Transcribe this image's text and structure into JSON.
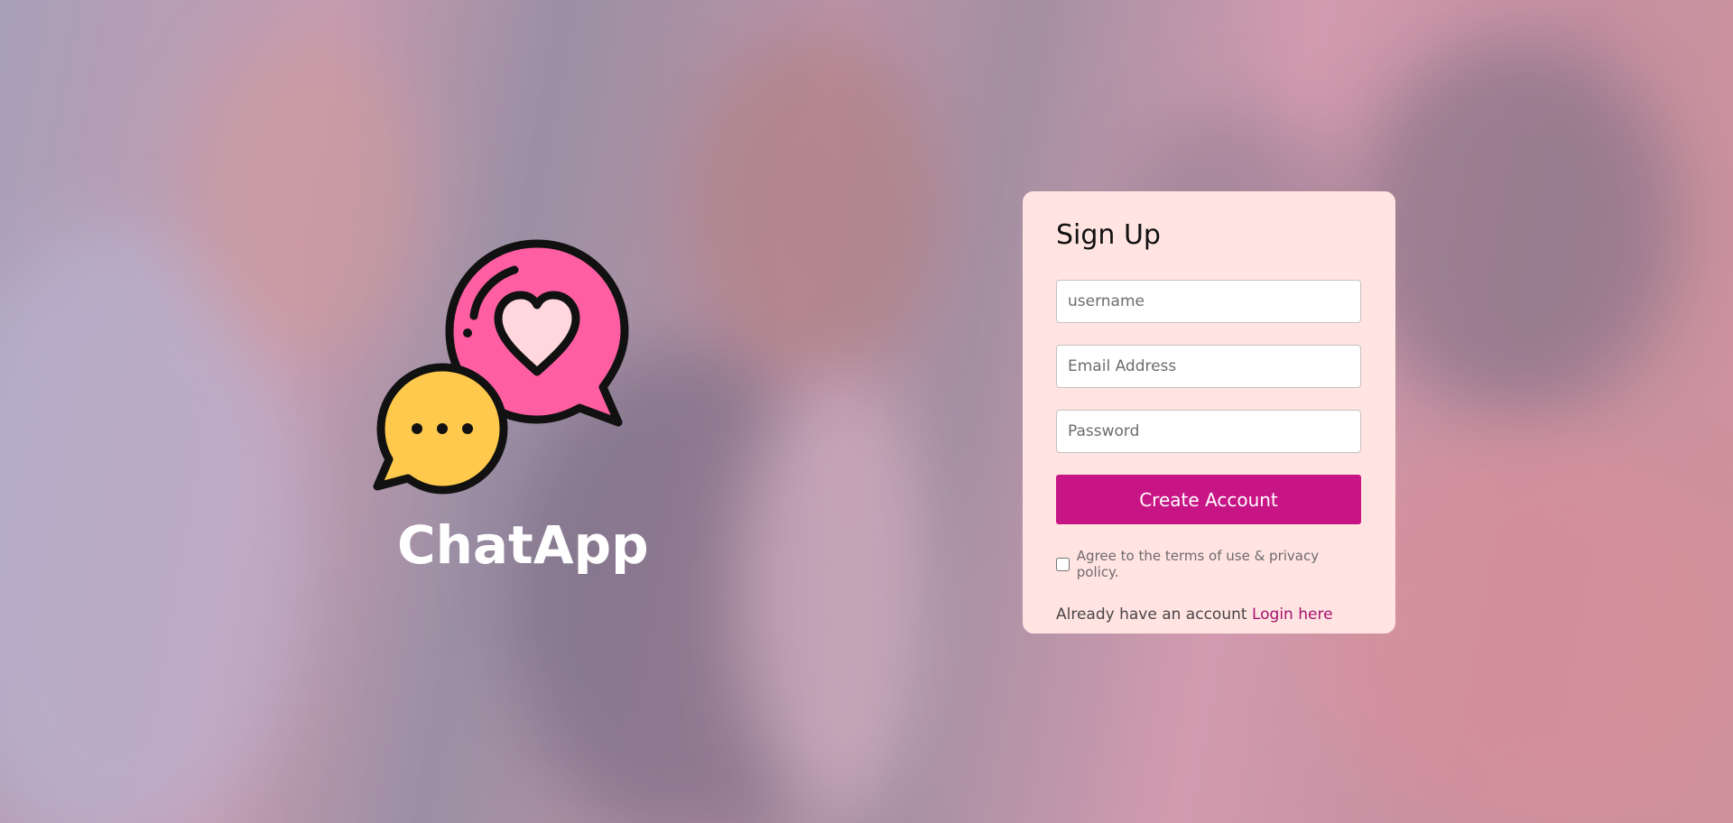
{
  "brand": {
    "name": "ChatApp",
    "logo_icon": "chat-bubbles-heart-icon"
  },
  "signup": {
    "title": "Sign Up",
    "username_placeholder": "username",
    "email_placeholder": "Email Address",
    "password_placeholder": "Password",
    "submit_label": "Create Account",
    "terms_label": "Agree to the terms of use & privacy policy.",
    "already_text": "Already have an account",
    "login_link_label": "Login here"
  },
  "colors": {
    "card_background": "#ffe4e1",
    "accent": "#c71585",
    "link": "#a4126e",
    "heart_bubble": "#ff5fa2",
    "dots_bubble": "#ffc94d"
  }
}
